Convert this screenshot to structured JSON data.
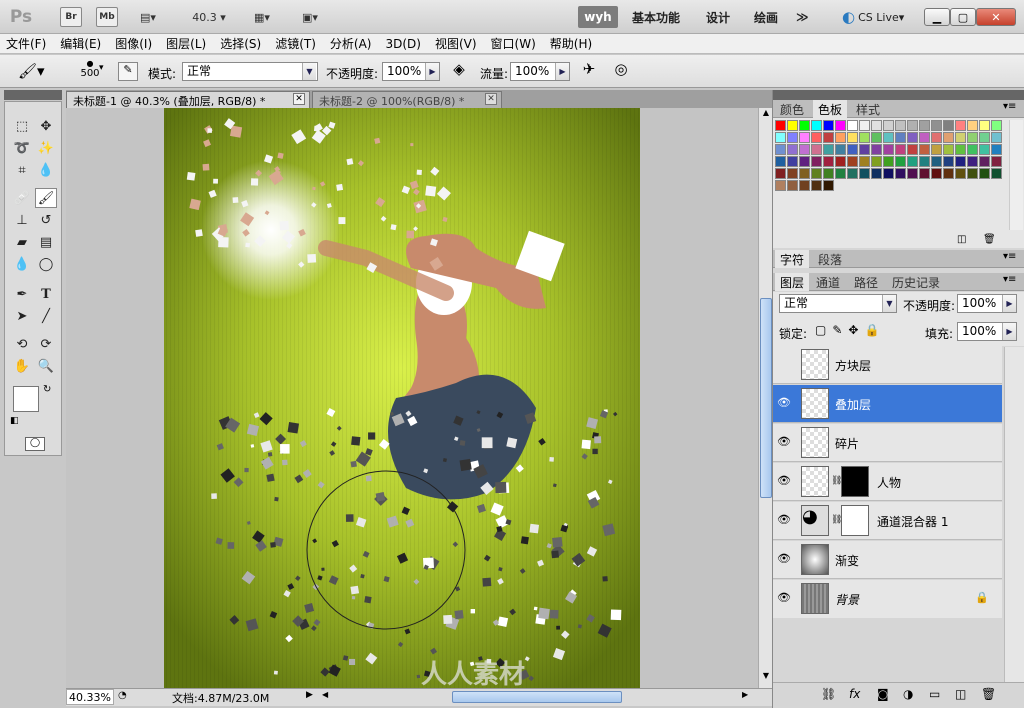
{
  "titlebar": {
    "ps_logo": "Ps",
    "br": "Br",
    "mb": "Mb",
    "zoom": "40.3",
    "workspaces": [
      "wyh",
      "基本功能",
      "设计",
      "绘画"
    ],
    "more": "≫",
    "cslive": "CS Live"
  },
  "menu": [
    "文件(F)",
    "编辑(E)",
    "图像(I)",
    "图层(L)",
    "选择(S)",
    "滤镜(T)",
    "分析(A)",
    "3D(D)",
    "视图(V)",
    "窗口(W)",
    "帮助(H)"
  ],
  "options": {
    "brush_size": "500",
    "mode_label": "模式:",
    "mode_value": "正常",
    "opacity_label": "不透明度:",
    "opacity_value": "100%",
    "flow_label": "流量:",
    "flow_value": "100%"
  },
  "doc_tabs": [
    {
      "title": "未标题-1 @ 40.3% (叠加层, RGB/8) *",
      "active": true
    },
    {
      "title": "未标题-2 @ 100%(RGB/8) *",
      "active": false
    }
  ],
  "status": {
    "zoom": "40.33%",
    "doc": "文档:4.87M/23.0M"
  },
  "watermark": "人人素材",
  "panels": {
    "swatches_tabs": [
      "颜色",
      "色板",
      "样式"
    ],
    "char_tabs": [
      "字符",
      "段落"
    ],
    "layer_tabs": [
      "图层",
      "通道",
      "路径",
      "历史记录"
    ],
    "blend_mode": "正常",
    "opacity_label": "不透明度:",
    "opacity_value": "100%",
    "lock_label": "锁定:",
    "fill_label": "填充:",
    "fill_value": "100%"
  },
  "layers": [
    {
      "name": "方块层",
      "visible": false,
      "selected": false
    },
    {
      "name": "叠加层",
      "visible": true,
      "selected": true
    },
    {
      "name": "碎片",
      "visible": true,
      "selected": false
    },
    {
      "name": "人物",
      "visible": true,
      "selected": false
    },
    {
      "name": "通道混合器 1",
      "visible": true,
      "selected": false
    },
    {
      "name": "渐变",
      "visible": true,
      "selected": false
    },
    {
      "name": "背景",
      "visible": true,
      "selected": false
    }
  ],
  "swatch_colors": [
    "#ff0000",
    "#ffff00",
    "#00ff00",
    "#00ffff",
    "#0000ff",
    "#ff00ff",
    "#ffffff",
    "#f0f0f0",
    "#e0e0e0",
    "#d0d0d0",
    "#c0c0c0",
    "#b0b0b0",
    "#a0a0a0",
    "#909090",
    "#808080",
    "#ff8080",
    "#ffd080",
    "#ffff80",
    "#80ff80",
    "#80ffff",
    "#8080ff",
    "#ff80ff",
    "#ff6060",
    "#c04040",
    "#ffa060",
    "#ffe060",
    "#a0e060",
    "#60c060",
    "#60c0c0",
    "#6080c0",
    "#8060c0",
    "#c060c0",
    "#e07070",
    "#e0a070",
    "#d0d070",
    "#90d070",
    "#70d090",
    "#70c0d0",
    "#7090d0",
    "#9070d0",
    "#c070d0",
    "#d07090",
    "#40a0a0",
    "#4080a0",
    "#4060c0",
    "#6040a0",
    "#8040a0",
    "#a040a0",
    "#c04080",
    "#c04040",
    "#c06040",
    "#c0a040",
    "#a0c040",
    "#60c040",
    "#40c060",
    "#40c0a0",
    "#2080c0",
    "#2060a0",
    "#4040a0",
    "#602080",
    "#802060",
    "#a02040",
    "#a02020",
    "#a04020",
    "#a08020",
    "#80a020",
    "#40a020",
    "#20a040",
    "#20a080",
    "#208080",
    "#206080",
    "#204080",
    "#202080",
    "#402080",
    "#602060",
    "#802040",
    "#802020",
    "#804020",
    "#806020",
    "#608020",
    "#408020",
    "#208040",
    "#207060",
    "#105060",
    "#103060",
    "#101060",
    "#301060",
    "#501050",
    "#601030",
    "#601010",
    "#603010",
    "#605010",
    "#405010",
    "#205010",
    "#105030",
    "#b08060",
    "#906040",
    "#704020",
    "#503010",
    "#301800"
  ]
}
